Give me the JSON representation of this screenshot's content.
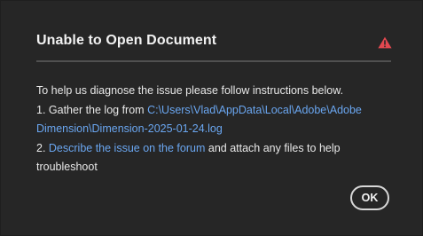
{
  "dialog": {
    "title": "Unable to Open Document",
    "icon": "warning-icon",
    "colors": {
      "background": "#262626",
      "warning": "#e34850",
      "link": "#6aa6f0",
      "divider": "#505050"
    }
  },
  "message": {
    "intro": "To help us diagnose the issue please follow instructions below.",
    "step1_prefix": "1. Gather the log from ",
    "step1_link_part1": "C:\\Users\\Vlad\\AppData\\Local\\Adobe\\Adobe",
    "step1_link_part2": "Dimension\\Dimension-2025-01-24.log",
    "step2_prefix": "2. ",
    "step2_link": "Describe the issue on the forum",
    "step2_suffix": " and attach any files to help",
    "step2_suffix_line2": "troubleshoot"
  },
  "buttons": {
    "ok_label": "OK"
  }
}
